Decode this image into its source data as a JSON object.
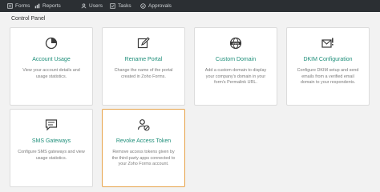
{
  "nav": {
    "items": [
      {
        "label": "Forms"
      },
      {
        "label": "Reports"
      },
      {
        "label": "Users"
      },
      {
        "label": "Tasks"
      },
      {
        "label": "Approvals"
      }
    ]
  },
  "panel": {
    "title": "Control Panel"
  },
  "cards": [
    {
      "title": "Account Usage",
      "desc": "View your account details and usage statistics."
    },
    {
      "title": "Rename Portal",
      "desc": "Change the name of the portal created in Zoho Forms."
    },
    {
      "title": "Custom Domain",
      "desc": "Add a custom domain to display your company's domain in your form's Permalink URL."
    },
    {
      "title": "DKIM Configuration",
      "desc": "Configure DKIM setup and send emails from a verified email domain to your respondents."
    },
    {
      "title": "SMS Gateways",
      "desc": "Configure SMS gateways and view usage statistics."
    },
    {
      "title": "Revoke Access Token",
      "desc": "Remove access tokens given by the third-party apps connected to your Zoho Forms account."
    }
  ],
  "colors": {
    "accent": "#1f8f7a",
    "active_border": "#e7a34a",
    "nav_bg": "#2b2f33"
  }
}
